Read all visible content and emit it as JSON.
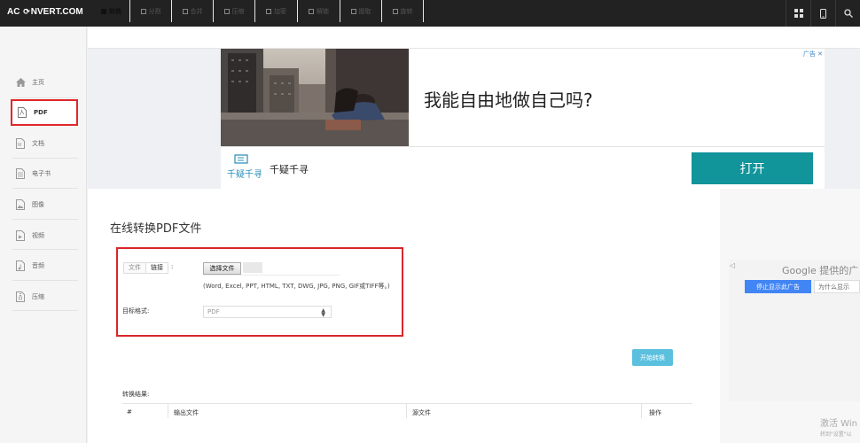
{
  "header": {
    "logo_left": "AC",
    "logo_right": "NVERT.COM",
    "icons": [
      "grid-icon",
      "mobile-icon",
      "search-icon"
    ]
  },
  "sidebar": {
    "items": [
      {
        "label": "主页",
        "icon": "home-icon"
      },
      {
        "label": "PDF",
        "icon": "pdf-icon",
        "active": true
      },
      {
        "label": "文档",
        "icon": "word-icon"
      },
      {
        "label": "电子书",
        "icon": "ebook-icon"
      },
      {
        "label": "图像",
        "icon": "image-icon"
      },
      {
        "label": "视频",
        "icon": "video-icon"
      },
      {
        "label": "音频",
        "icon": "audio-icon"
      },
      {
        "label": "压缩",
        "icon": "archive-icon"
      }
    ]
  },
  "tabs": [
    {
      "label": "转换",
      "active": true
    },
    {
      "label": "分割"
    },
    {
      "label": "合并"
    },
    {
      "label": "压缩"
    },
    {
      "label": "加密"
    },
    {
      "label": "解锁"
    },
    {
      "label": "提取"
    },
    {
      "label": "旋转"
    }
  ],
  "ad": {
    "close_label": "广告 ✕",
    "headline": "我能自由地做自己吗?",
    "brand_name": "千疑千寻",
    "brand_logo_text": "千疑千寻",
    "open_label": "打开"
  },
  "main": {
    "title": "在线转换PDF文件",
    "source_tabs": [
      "文件",
      "链接"
    ],
    "colon": ":",
    "file_button": "选择文件",
    "hint": "(Word, Excel, PPT, HTML, TXT, DWG, JPG, PNG, GIF或TIFF等。)",
    "target_label": "目标格式:",
    "target_value": "PDF",
    "start_button": "开始转换",
    "result_label": "转换结果:",
    "table_headers": [
      "#",
      "输出文件",
      "源文件",
      "操作"
    ]
  },
  "google_ad": {
    "title": "Google 提供的广",
    "stop_label": "停止显示此广告",
    "why_label": "为什么显示",
    "arrow": "◁"
  },
  "watermark": {
    "line1": "激活 Win",
    "line2": "转到\"设置\"以"
  },
  "colors": {
    "accent_red": "#e0262b",
    "open_teal": "#12949b",
    "start_blue": "#5bc0de",
    "google_blue": "#4285f4"
  }
}
